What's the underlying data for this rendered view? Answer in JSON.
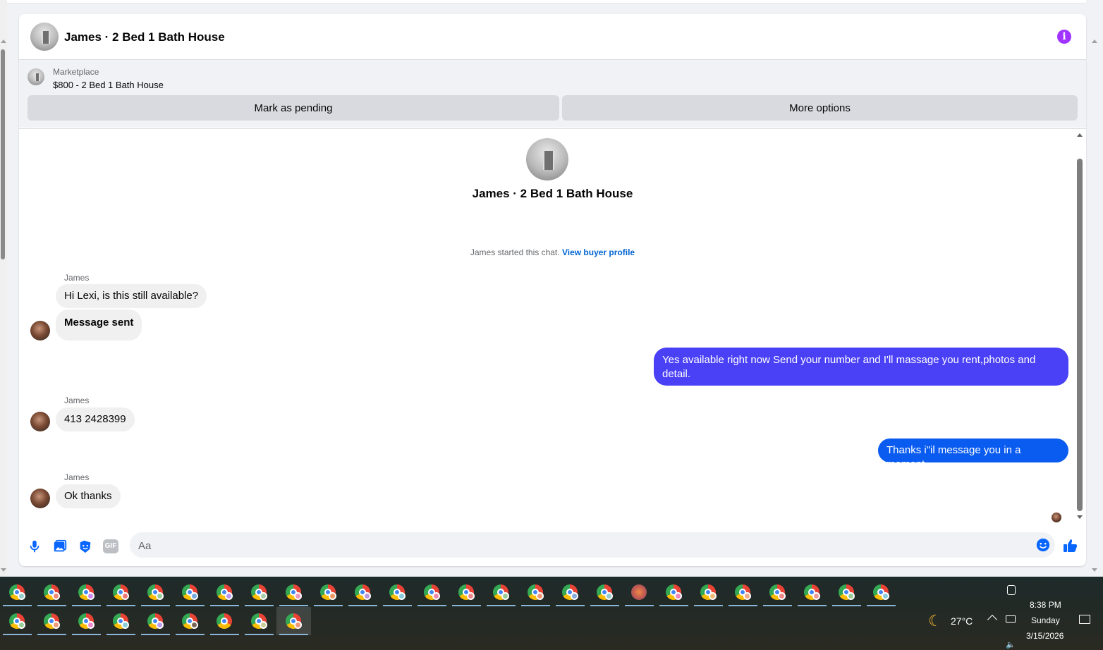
{
  "conversation": {
    "title": "James · 2 Bed 1 Bath House",
    "info_icon": "info-icon"
  },
  "listing": {
    "category": "Marketplace",
    "product_title": "$800 - 2 Bed 1 Bath House",
    "pending_label": "Mark as pending",
    "more_label": "More options"
  },
  "thread": {
    "chat_name": "James · 2 Bed 1 Bath House",
    "started_text": "James started this chat.",
    "buyer_profile_link": "View buyer profile",
    "messages": [
      {
        "sender": "James",
        "text": "Hi Lexi, is this still available?"
      },
      {
        "text": "Message sent"
      },
      {
        "text": "Yes available right now Send your number and I'll massage you rent,photos and detail."
      },
      {
        "sender": "James",
        "text": "413 2428399"
      },
      {
        "text": "Thanks i\"il message you in a moment"
      },
      {
        "sender": "James",
        "text": "Ok thanks"
      }
    ]
  },
  "composer": {
    "placeholder": "Aa",
    "icons": [
      "microphone-icon",
      "photo-icon",
      "sticker-icon",
      "gif-icon",
      "emoji-icon",
      "thumbs-up-icon"
    ],
    "gif_label": "GIF"
  },
  "taskbar": {
    "weather_temp": "27°C",
    "time": "8:38 PM",
    "day": "Sunday",
    "date": "3/15/2026"
  },
  "colors": {
    "outgoing_bubble_1": "#4a40f5",
    "outgoing_bubble_2": "#0a5cf0",
    "incoming_bubble": "#f0f0f0",
    "accent": "#0866ff",
    "info": "#a033ff"
  }
}
